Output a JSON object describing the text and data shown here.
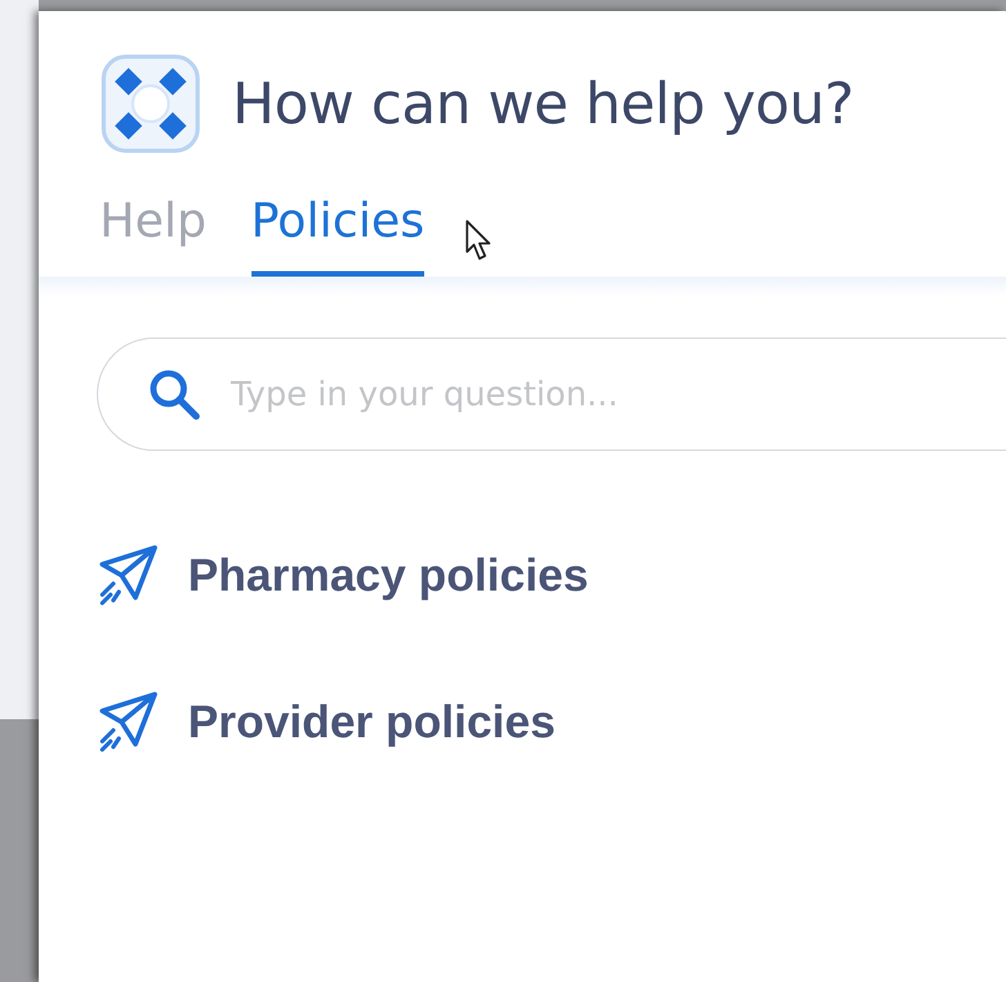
{
  "header": {
    "title": "How can we help you?"
  },
  "tabs": [
    {
      "label": "Help",
      "selected": false
    },
    {
      "label": "Policies",
      "selected": true
    }
  ],
  "search": {
    "placeholder": "Type in your question..."
  },
  "links": [
    {
      "label": "Pharmacy policies"
    },
    {
      "label": "Provider policies"
    }
  ]
}
